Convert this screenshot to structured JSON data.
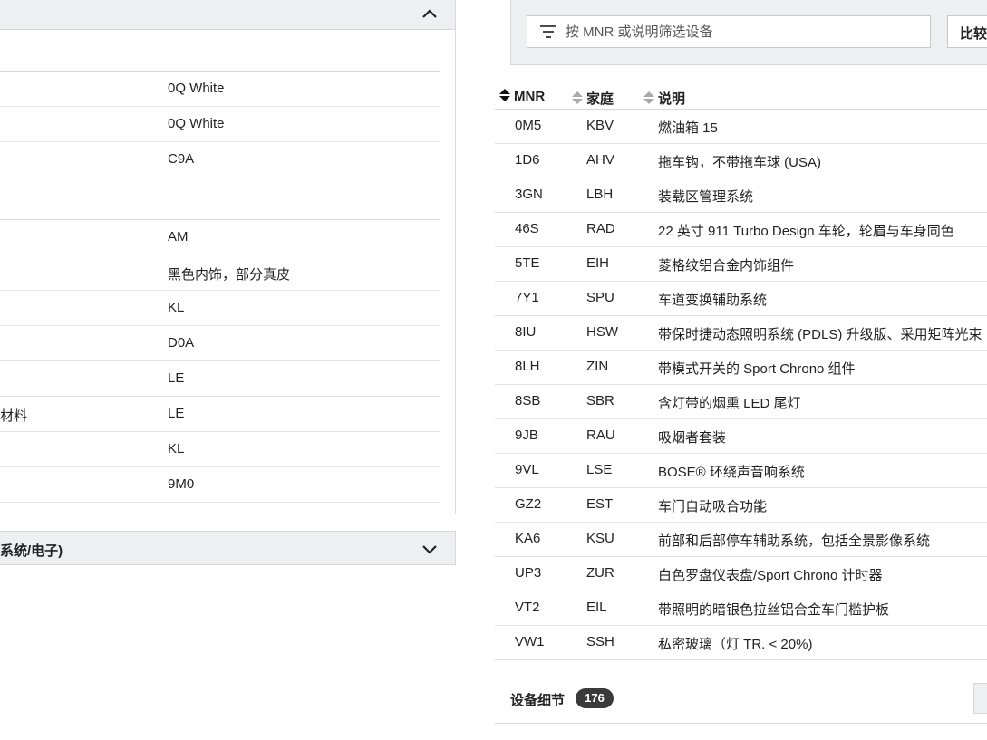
{
  "left": {
    "spec_rows": [
      {
        "label": "",
        "value": "0Q White"
      },
      {
        "label": "",
        "value": "0Q White"
      },
      {
        "label": "",
        "value": "C9A"
      },
      {
        "label": "",
        "value": "AM"
      },
      {
        "label": "",
        "value": "黑色内饰，部分真皮"
      },
      {
        "label": "",
        "value": "KL"
      },
      {
        "label": "",
        "value": "D0A"
      },
      {
        "label": "",
        "value": "LE"
      },
      {
        "label": "材料",
        "value": "LE"
      },
      {
        "label": "",
        "value": "KL"
      },
      {
        "label": "",
        "value": "9M0"
      }
    ],
    "collapsed_section_title": "系统/电子)"
  },
  "filter": {
    "placeholder": "按 MNR 或说明筛选设备",
    "compare_label": "比较"
  },
  "table": {
    "headers": {
      "mnr": "MNR",
      "family": "家庭",
      "description": "说明"
    },
    "rows": [
      {
        "mnr": "0M5",
        "family": "KBV",
        "description": "燃油箱 15"
      },
      {
        "mnr": "1D6",
        "family": "AHV",
        "description": "拖车钩，不带拖车球 (USA)"
      },
      {
        "mnr": "3GN",
        "family": "LBH",
        "description": "装载区管理系统"
      },
      {
        "mnr": "46S",
        "family": "RAD",
        "description": "22 英寸 911 Turbo Design 车轮，轮眉与车身同色"
      },
      {
        "mnr": "5TE",
        "family": "EIH",
        "description": "菱格纹铝合金内饰组件"
      },
      {
        "mnr": "7Y1",
        "family": "SPU",
        "description": "车道变换辅助系统"
      },
      {
        "mnr": "8IU",
        "family": "HSW",
        "description": "带保时捷动态照明系统 (PDLS) 升级版、采用矩阵光束"
      },
      {
        "mnr": "8LH",
        "family": "ZIN",
        "description": "带模式开关的 Sport Chrono 组件"
      },
      {
        "mnr": "8SB",
        "family": "SBR",
        "description": "含灯带的烟熏 LED 尾灯"
      },
      {
        "mnr": "9JB",
        "family": "RAU",
        "description": "吸烟者套装"
      },
      {
        "mnr": "9VL",
        "family": "LSE",
        "description": "BOSE® 环绕声音响系统"
      },
      {
        "mnr": "GZ2",
        "family": "EST",
        "description": "车门自动吸合功能"
      },
      {
        "mnr": "KA6",
        "family": "KSU",
        "description": "前部和后部停车辅助系统，包括全景影像系统"
      },
      {
        "mnr": "UP3",
        "family": "ZUR",
        "description": "白色罗盘仪表盘/Sport Chrono 计时器"
      },
      {
        "mnr": "VT2",
        "family": "EIL",
        "description": "带照明的暗银色拉丝铝合金车门槛护板"
      },
      {
        "mnr": "VW1",
        "family": "SSH",
        "description": "私密玻璃（灯 TR. < 20%)"
      }
    ]
  },
  "details": {
    "title": "设备细节",
    "count": "176"
  }
}
